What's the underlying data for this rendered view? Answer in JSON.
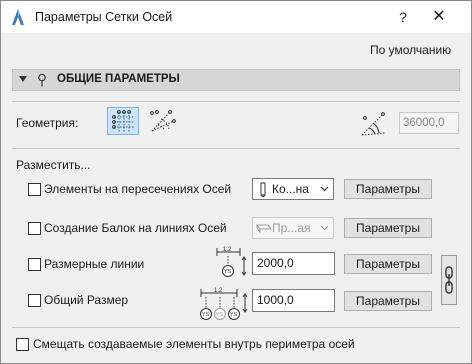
{
  "window": {
    "title": "Параметры Сетки Осей",
    "help": "?",
    "close": "✕"
  },
  "defaults_label": "По умолчанию",
  "section": {
    "title": "ОБЩИЕ ПАРАМЕТРЫ"
  },
  "geometry": {
    "label": "Геометрия:",
    "options": [
      "rectangular-grid",
      "radial-grid"
    ],
    "selected": "rectangular-grid",
    "angle_value": "36000,0"
  },
  "place": {
    "label": "Разместить...",
    "rows": [
      {
        "label": "Элементы на пересечениях Осей",
        "checked": false,
        "dropdown": "Ко...на",
        "dropdown_enabled": true,
        "button": "Параметры"
      },
      {
        "label": "Создание Балок на линиях Осей",
        "checked": false,
        "dropdown": "Пр...ая",
        "dropdown_enabled": false,
        "button": "Параметры"
      },
      {
        "label": "Размерные линии",
        "checked": false,
        "value": "2000,0",
        "button": "Параметры"
      },
      {
        "label": "Общий Размер",
        "checked": false,
        "value": "1000,0",
        "button": "Параметры"
      }
    ]
  },
  "dimension_icon_text": {
    "dim_value": "1.2",
    "ys": "YS"
  },
  "bottom_option": {
    "label": "Смещать создаваемые элементы внутрь периметра осей",
    "checked": false
  },
  "colors": {
    "selected_bg": "#cce4f7",
    "selected_border": "#7eb4ea",
    "section_bg": "#d6d6d6"
  }
}
